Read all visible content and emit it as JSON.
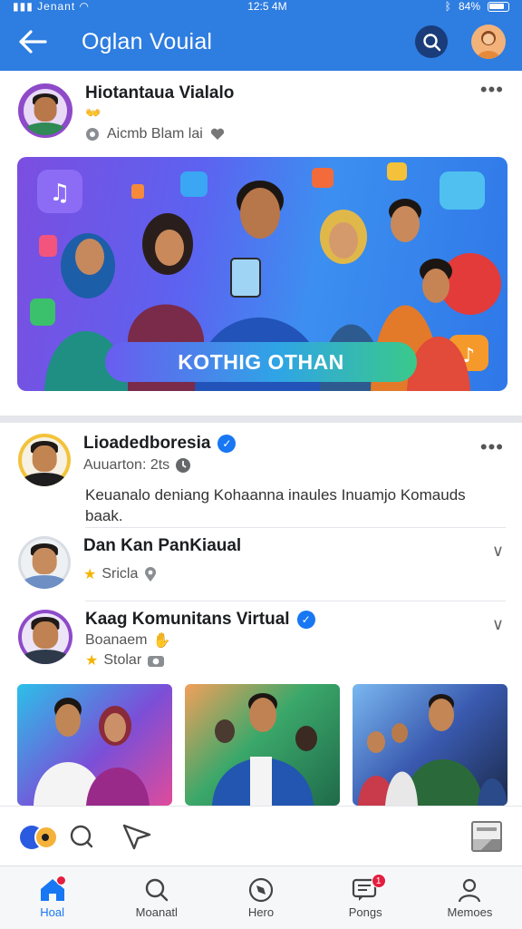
{
  "status": {
    "carrier": "Jenant",
    "time": "12:5 4M",
    "battery": "84%"
  },
  "app": {
    "title": "Oglan Vouial"
  },
  "post": {
    "author": "Hiotantaua Vialalo",
    "emoji": "👐",
    "subtitle": "Aicmb Blam lai",
    "more": "•••",
    "banner_cta": "KOTHIG OTHAN"
  },
  "list": [
    {
      "name": "Lioadedboresia",
      "verified": true,
      "sub": "Auuarton: 2ts",
      "desc": "Keuanalo deniang Kohaanna inaules Inuamjo Komauds baak.",
      "more": "•••"
    },
    {
      "name": "Dan Kan PanKiaual",
      "sub": "Sricla",
      "chevron": "∨"
    },
    {
      "name": "Kaag Komunitans Virtual",
      "verified": true,
      "tag": "Boanaem",
      "sub": "Stolar",
      "chevron": "∨"
    }
  ],
  "nav": [
    {
      "label": "Hoal",
      "icon": "home-icon",
      "active": true,
      "badge": true
    },
    {
      "label": "Moanatl",
      "icon": "search-icon"
    },
    {
      "label": "Hero",
      "icon": "compass-icon"
    },
    {
      "label": "Pongs",
      "icon": "message-icon",
      "badge": true,
      "badge_count": "1"
    },
    {
      "label": "Memoes",
      "icon": "person-icon"
    }
  ],
  "colors": {
    "brand": "#2e7de0",
    "active": "#1877f2",
    "badge": "#e41e3f"
  }
}
